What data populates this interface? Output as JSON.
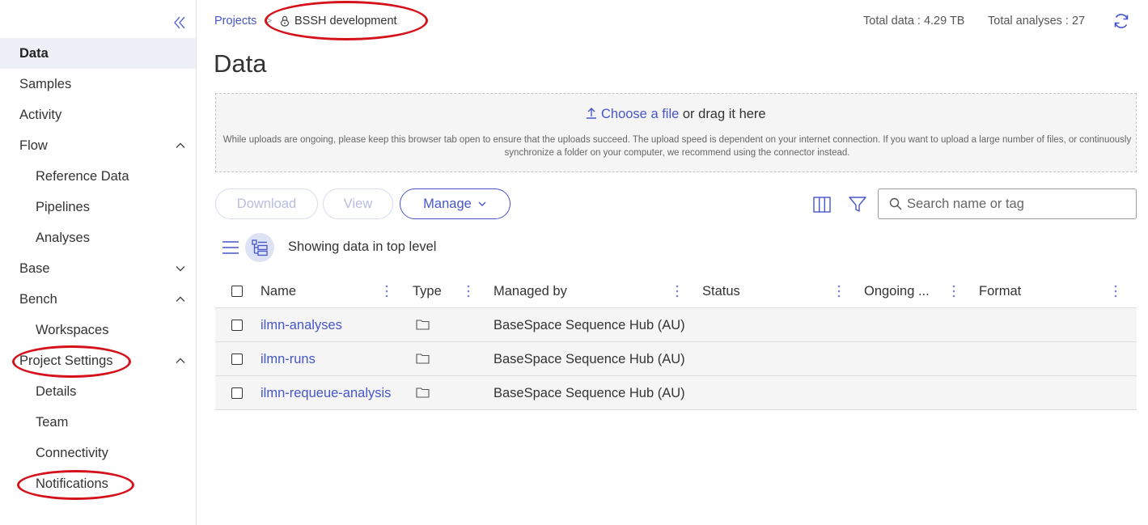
{
  "sidebar": {
    "items": [
      {
        "label": "Data"
      },
      {
        "label": "Samples"
      },
      {
        "label": "Activity"
      },
      {
        "label": "Flow"
      },
      {
        "label": "Reference Data"
      },
      {
        "label": "Pipelines"
      },
      {
        "label": "Analyses"
      },
      {
        "label": "Base"
      },
      {
        "label": "Bench"
      },
      {
        "label": "Workspaces"
      },
      {
        "label": "Project Settings"
      },
      {
        "label": "Details"
      },
      {
        "label": "Team"
      },
      {
        "label": "Connectivity"
      },
      {
        "label": "Notifications"
      }
    ]
  },
  "header": {
    "breadcrumb_root": "Projects",
    "breadcrumb_separator": ">",
    "breadcrumb_current": "BSSH development",
    "total_data": "Total data : 4.29 TB",
    "total_analyses": "Total analyses : 27"
  },
  "page": {
    "title": "Data"
  },
  "upload": {
    "choose_link": "Choose a file",
    "drag_text": " or drag it here",
    "note": "While uploads are ongoing, please keep this browser tab open to ensure that the uploads succeed. The upload speed is dependent on your internet connection. If you want to upload a large number of files, or continuously synchronize a folder on your computer, we recommend using the connector instead."
  },
  "toolbar": {
    "download_label": "Download",
    "view_label": "View",
    "manage_label": "Manage",
    "search_placeholder": "Search name or tag",
    "showing_text": "Showing data in top level"
  },
  "table": {
    "columns": [
      "Name",
      "Type",
      "Managed by",
      "Status",
      "Ongoing ...",
      "Format"
    ],
    "rows": [
      {
        "name": "ilmn-analyses",
        "type": "folder-icon",
        "managed_by": "BaseSpace Sequence Hub (AU)",
        "status": "",
        "ongoing": "",
        "format": ""
      },
      {
        "name": "ilmn-runs",
        "type": "folder-icon",
        "managed_by": "BaseSpace Sequence Hub (AU)",
        "status": "",
        "ongoing": "",
        "format": ""
      },
      {
        "name": "ilmn-requeue-analysis",
        "type": "folder-icon",
        "managed_by": "BaseSpace Sequence Hub (AU)",
        "status": "",
        "ongoing": "",
        "format": ""
      }
    ]
  },
  "colors": {
    "accent": "#4656c8",
    "annotation": "#d5121b",
    "active_nav_bg": "#edf0f7"
  }
}
